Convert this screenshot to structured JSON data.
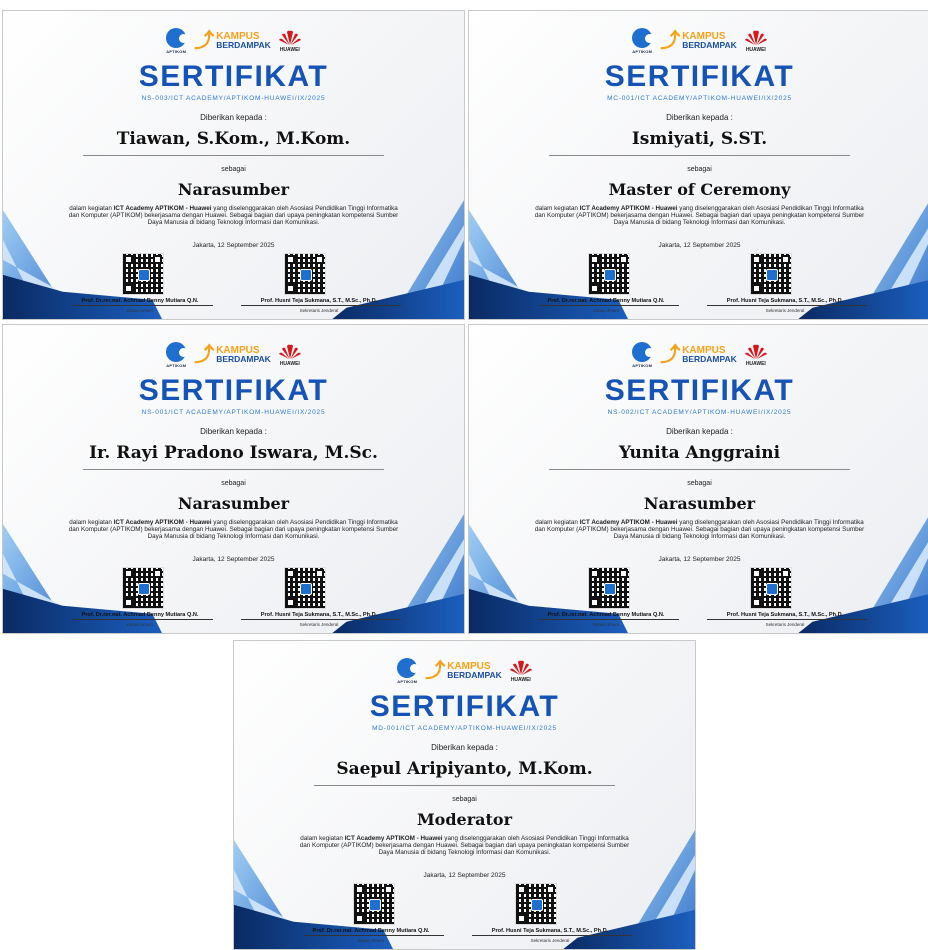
{
  "certificates": [
    {
      "logos": {
        "aptikom": "APTIKOM",
        "kampus_line1": "KAMPUS",
        "kampus_line2": "BERDAMPAK",
        "huawei": "HUAWEI"
      },
      "title": "SERTIFIKAT",
      "number": "NS-003/ICT ACADEMY/APTIKOM-HUAWEI/IX/2025",
      "given_to": "Diberikan kepada :",
      "name": "Tiawan, S.Kom., M.Kom.",
      "as": "sebagai",
      "role": "Narasumber",
      "desc_pre": "dalam kegiatan ",
      "desc_bold": "ICT Academy APTIKOM - Huawei",
      "desc_post": " yang diselenggarakan oleh Asosiasi Pendidikan Tinggi Informatika dan Komputer (APTIKOM) bekerjasama dengan Huawei. Sebagai bagian dari upaya peningkatan kompetensi Sumber Daya Manusia di bidang Teknologi Informasi dan Komunikasi.",
      "date": "Jakarta, 12 September 2025",
      "signer_left": "Prof. Dr.rer.nat. Achmad Benny Mutiara Q.N.",
      "position_left": "Ketua Umum",
      "signer_right": "Prof. Husni Teja Sukmana, S.T., M.Sc., Ph.D.",
      "position_right": "Sekretaris Jenderal"
    },
    {
      "logos": {
        "aptikom": "APTIKOM",
        "kampus_line1": "KAMPUS",
        "kampus_line2": "BERDAMPAK",
        "huawei": "HUAWEI"
      },
      "title": "SERTIFIKAT",
      "number": "MC-001/ICT ACADEMY/APTIKOM-HUAWEI/IX/2025",
      "given_to": "Diberikan kepada :",
      "name": "Ismiyati, S.ST.",
      "as": "sebagai",
      "role": "Master of Ceremony",
      "desc_pre": "dalam kegiatan ",
      "desc_bold": "ICT Academy APTIKOM - Huawei",
      "desc_post": " yang diselenggarakan oleh Asosiasi Pendidikan Tinggi Informatika dan Komputer (APTIKOM) bekerjasama dengan Huawei. Sebagai bagian dari upaya peningkatan kompetensi Sumber Daya Manusia di bidang Teknologi Informasi dan Komunikasi.",
      "date": "Jakarta, 12 September 2025",
      "signer_left": "Prof. Dr.rer.nat. Achmad Benny Mutiara Q.N.",
      "position_left": "Ketua Umum",
      "signer_right": "Prof. Husni Teja Sukmana, S.T., M.Sc., Ph.D.",
      "position_right": "Sekretaris Jenderal"
    },
    {
      "logos": {
        "aptikom": "APTIKOM",
        "kampus_line1": "KAMPUS",
        "kampus_line2": "BERDAMPAK",
        "huawei": "HUAWEI"
      },
      "title": "SERTIFIKAT",
      "number": "NS-001/ICT ACADEMY/APTIKOM-HUAWEI/IX/2025",
      "given_to": "Diberikan kepada :",
      "name": "Ir. Rayi Pradono Iswara, M.Sc.",
      "as": "sebagai",
      "role": "Narasumber",
      "desc_pre": "dalam kegiatan ",
      "desc_bold": "ICT Academy APTIKOM - Huawei",
      "desc_post": " yang diselenggarakan oleh Asosiasi Pendidikan Tinggi Informatika dan Komputer (APTIKOM) bekerjasama dengan Huawei. Sebagai bagian dari upaya peningkatan kompetensi Sumber Daya Manusia di bidang Teknologi Informasi dan Komunikasi.",
      "date": "Jakarta, 12 September 2025",
      "signer_left": "Prof. Dr.rer.nat. Achmad Benny Mutiara Q.N.",
      "position_left": "Ketua Umum",
      "signer_right": "Prof. Husni Teja Sukmana, S.T., M.Sc., Ph.D.",
      "position_right": "Sekretaris Jenderal"
    },
    {
      "logos": {
        "aptikom": "APTIKOM",
        "kampus_line1": "KAMPUS",
        "kampus_line2": "BERDAMPAK",
        "huawei": "HUAWEI"
      },
      "title": "SERTIFIKAT",
      "number": "NS-002/ICT ACADEMY/APTIKOM-HUAWEI/IX/2025",
      "given_to": "Diberikan kepada :",
      "name": "Yunita Anggraini",
      "as": "sebagai",
      "role": "Narasumber",
      "desc_pre": "dalam kegiatan ",
      "desc_bold": "ICT Academy APTIKOM - Huawei",
      "desc_post": " yang diselenggarakan oleh Asosiasi Pendidikan Tinggi Informatika dan Komputer (APTIKOM) bekerjasama dengan Huawei. Sebagai bagian dari upaya peningkatan kompetensi Sumber Daya Manusia di bidang Teknologi Informasi dan Komunikasi.",
      "date": "Jakarta, 12 September 2025",
      "signer_left": "Prof. Dr.rer.nat. Achmad Benny Mutiara Q.N.",
      "position_left": "Ketua Umum",
      "signer_right": "Prof. Husni Teja Sukmana, S.T., M.Sc., Ph.D.",
      "position_right": "Sekretaris Jenderal"
    },
    {
      "logos": {
        "aptikom": "APTIKOM",
        "kampus_line1": "KAMPUS",
        "kampus_line2": "BERDAMPAK",
        "huawei": "HUAWEI"
      },
      "title": "SERTIFIKAT",
      "number": "MD-001/ICT ACADEMY/APTIKOM-HUAWEI/IX/2025",
      "given_to": "Diberikan kepada :",
      "name": "Saepul Aripiyanto, M.Kom.",
      "as": "sebagai",
      "role": "Moderator",
      "desc_pre": "dalam kegiatan ",
      "desc_bold": "ICT Academy APTIKOM - Huawei",
      "desc_post": " yang diselenggarakan oleh Asosiasi Pendidikan Tinggi Informatika dan Komputer (APTIKOM) bekerjasama dengan Huawei. Sebagai bagian dari upaya peningkatan kompetensi Sumber Daya Manusia di bidang Teknologi Informasi dan Komunikasi.",
      "date": "Jakarta, 12 September 2025",
      "signer_left": "Prof. Dr.rer.nat. Achmad Benny Mutiara Q.N.",
      "position_left": "Ketua Umum",
      "signer_right": "Prof. Husni Teja Sukmana, S.T., M.Sc., Ph.D.",
      "position_right": "Sekretaris Jenderal"
    }
  ],
  "colors": {
    "title": "#1553b6",
    "accent_dark": "#0b2f6b",
    "accent_light": "#4aa3ec",
    "kampus_orange": "#f3a21b",
    "huawei_red": "#d8171d"
  }
}
